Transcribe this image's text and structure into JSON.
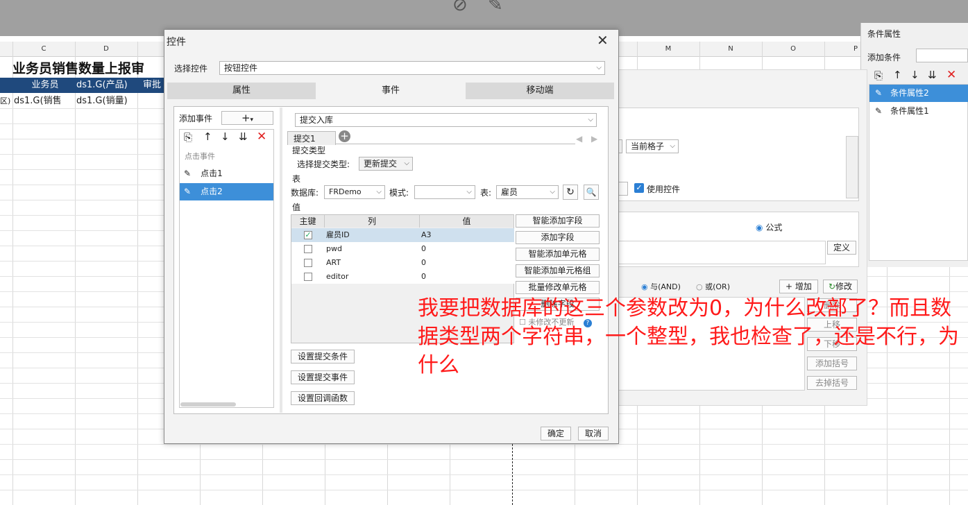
{
  "spreadsheet": {
    "columns": [
      "C",
      "D",
      "M",
      "N",
      "O",
      "P"
    ],
    "title": "业务员销售数量上报审",
    "header_cells": [
      "业务员",
      "ds1.G(产品)",
      "审批"
    ],
    "data_cells": [
      "区)",
      "ds1.G(销售",
      "ds1.G(销量)"
    ]
  },
  "right_panel": {
    "title": "条件属性",
    "add_label": "添加条件",
    "items": [
      "条件属性2",
      "条件属性1"
    ]
  },
  "mid_panel": {
    "current_cell": "当前格子",
    "use_control": "使用控件",
    "formula": "公式",
    "define": "定义",
    "and_label": "与(AND)",
    "or_label": "或(OR)",
    "add": "增加",
    "modify": "修改",
    "delete": "删除",
    "up": "上移",
    "down": "下移",
    "add_paren": "添加括号",
    "remove_paren": "去掉括号"
  },
  "dialog": {
    "title": "控件",
    "select_control_label": "选择控件",
    "select_control_value": "按钮控件",
    "tabs": [
      "属性",
      "事件",
      "移动端"
    ],
    "add_event_label": "添加事件",
    "event_group": "点击事件",
    "events": [
      "点击1",
      "点击2"
    ],
    "action_select": "提交入库",
    "sub_tab": "提交1",
    "submit_type_section": "提交类型",
    "submit_type_label": "选择提交类型:",
    "submit_type_value": "更新提交",
    "table_section": "表",
    "db_label": "数据库:",
    "db_value": "FRDemo",
    "schema_label": "模式:",
    "schema_value": "",
    "table_label": "表:",
    "table_value": "雇员",
    "value_section": "值",
    "grid_headers": [
      "主键",
      "列",
      "值"
    ],
    "grid_rows": [
      {
        "key": true,
        "column": "雇员ID",
        "value": "A3"
      },
      {
        "key": false,
        "column": "pwd",
        "value": "0"
      },
      {
        "key": false,
        "column": "ART",
        "value": "0"
      },
      {
        "key": false,
        "column": "editor",
        "value": "0"
      }
    ],
    "right_buttons": [
      "智能添加字段",
      "添加字段",
      "智能添加单元格",
      "智能添加单元格组",
      "批量修改单元格",
      "删除字段"
    ],
    "no_update_label": "未修改不更新",
    "bottom_buttons": [
      "设置提交条件",
      "设置提交事件",
      "设置回调函数"
    ],
    "ok": "确定",
    "cancel": "取消"
  },
  "annotation": "我要把数据库的这三个参数改为0，为什么改部了？而且数据类型两个字符串，一个整型，我也检查了，还是不行，为什么",
  "colors": {
    "header_blue": "#1f497d",
    "select_blue": "#3d8fd9",
    "annotation_red": "#ff1a1a"
  }
}
